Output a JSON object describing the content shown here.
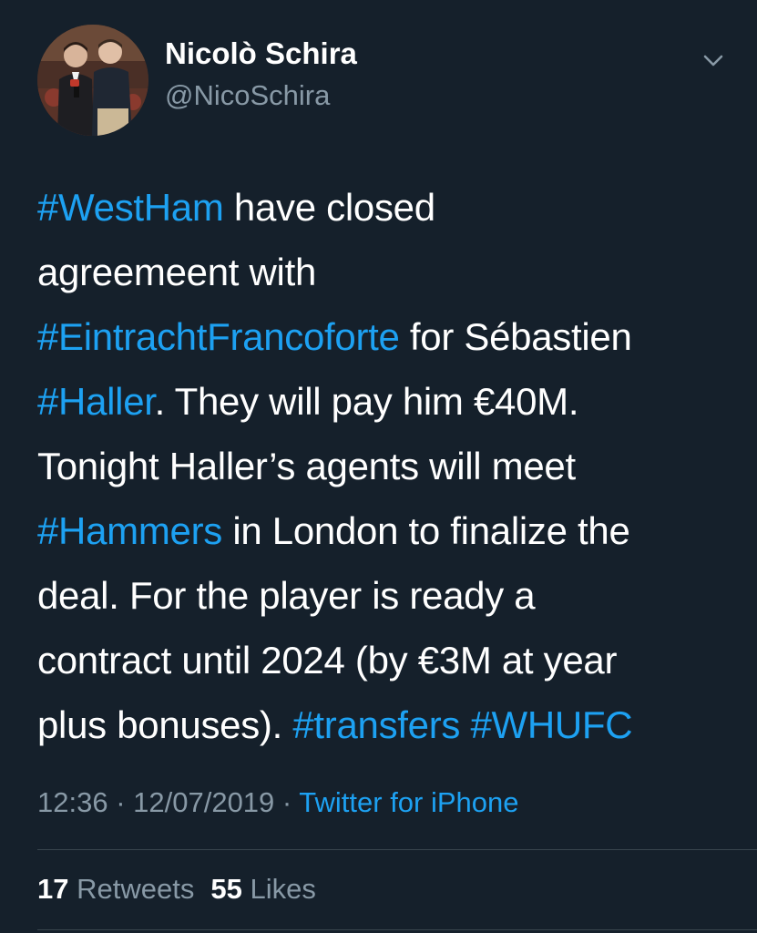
{
  "user": {
    "display_name": "Nicolò Schira",
    "handle": "@NicoSchira",
    "avatar_icon": "profile-photo-avatar"
  },
  "header": {
    "menu_icon": "chevron-down-icon"
  },
  "tweet": {
    "lines": [
      [
        {
          "text": "#WestHam",
          "hashtag": true
        },
        {
          "text": " have closed",
          "hashtag": false
        }
      ],
      [
        {
          "text": "agreemeent with",
          "hashtag": false
        }
      ],
      [
        {
          "text": "#EintrachtFrancoforte",
          "hashtag": true
        },
        {
          "text": " for Sébastien",
          "hashtag": false
        }
      ],
      [
        {
          "text": "#Haller",
          "hashtag": true
        },
        {
          "text": ". They will pay him €40M.",
          "hashtag": false
        }
      ],
      [
        {
          "text": "Tonight Haller’s agents will meet",
          "hashtag": false
        }
      ],
      [
        {
          "text": "#Hammers",
          "hashtag": true
        },
        {
          "text": " in London to finalize the",
          "hashtag": false
        }
      ],
      [
        {
          "text": "deal. For the player is ready a",
          "hashtag": false
        }
      ],
      [
        {
          "text": "contract until 2024 (by €3M at year",
          "hashtag": false
        }
      ],
      [
        {
          "text": "plus bonuses). ",
          "hashtag": false
        },
        {
          "text": "#transfers",
          "hashtag": true
        },
        {
          "text": " ",
          "hashtag": false
        },
        {
          "text": "#WHUFC",
          "hashtag": true
        }
      ]
    ]
  },
  "meta": {
    "time": "12:36",
    "separator": " · ",
    "date": "12/07/2019",
    "source": "Twitter for iPhone"
  },
  "stats": {
    "retweet_count": "17",
    "retweet_label": "Retweets",
    "like_count": "55",
    "like_label": "Likes"
  },
  "colors": {
    "background": "#15202b",
    "text": "#ffffff",
    "secondary": "#8899a6",
    "accent": "#1da1f2",
    "divider": "#38444d"
  }
}
